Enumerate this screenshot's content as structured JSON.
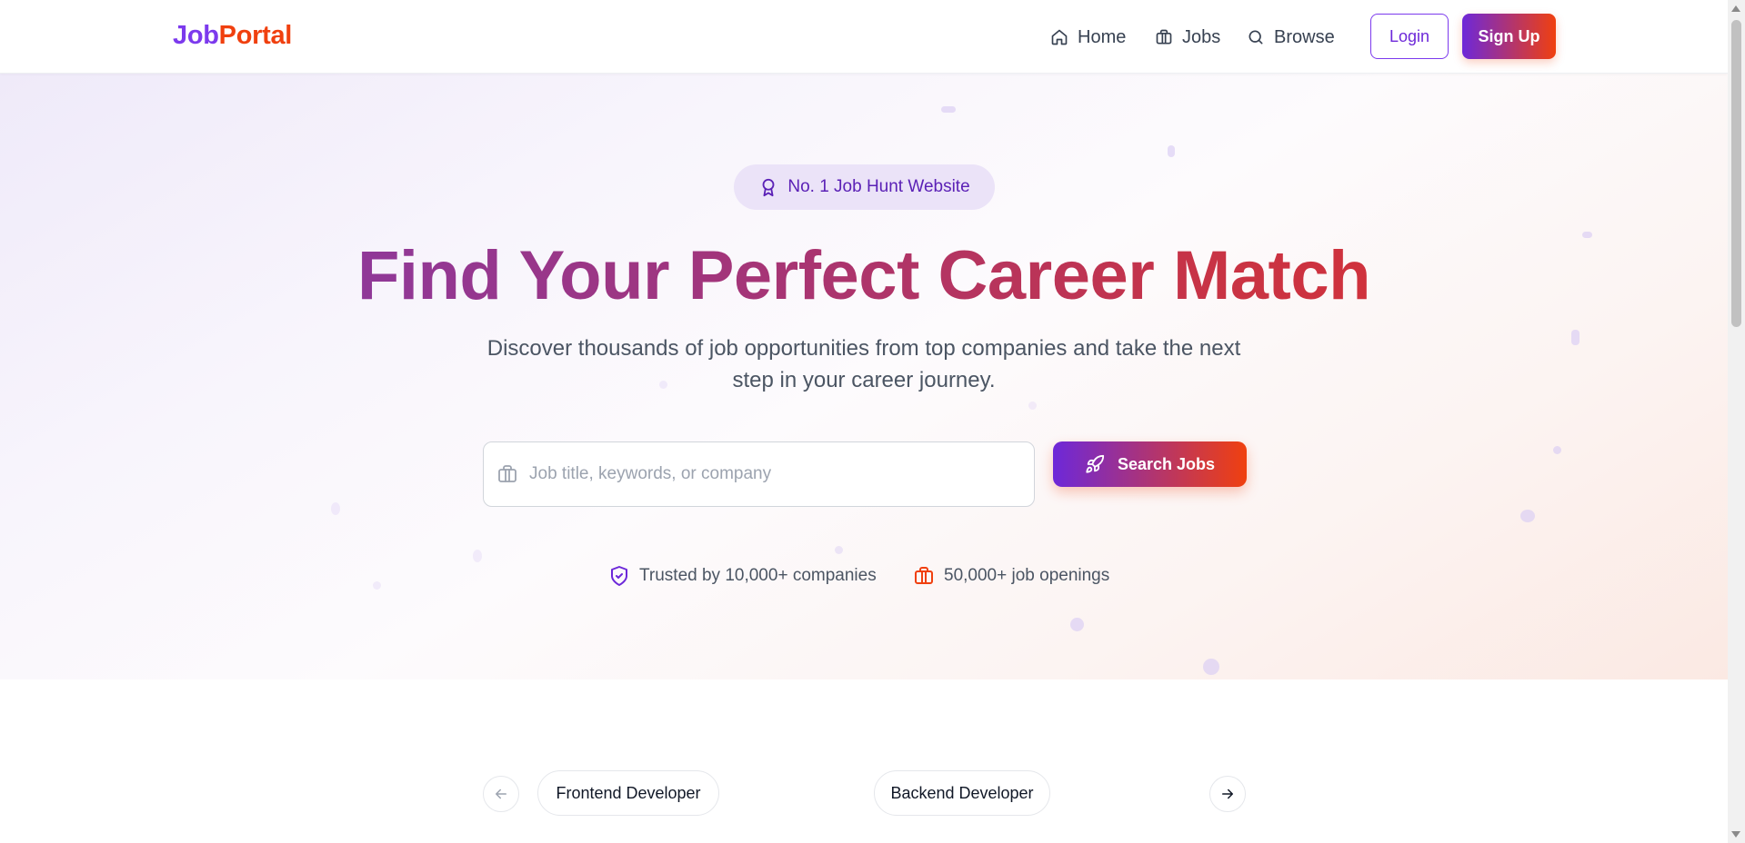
{
  "navbar": {
    "logo_part1": "Job",
    "logo_part2": "Portal",
    "links": [
      {
        "label": "Home",
        "icon": "home-icon"
      },
      {
        "label": "Jobs",
        "icon": "briefcase-icon"
      },
      {
        "label": "Browse",
        "icon": "search-icon"
      }
    ],
    "login_label": "Login",
    "signup_label": "Sign Up"
  },
  "hero": {
    "badge_label": "No. 1 Job Hunt Website",
    "badge_icon": "award-icon",
    "headline": "Find Your Perfect Career Match",
    "subtitle": "Discover thousands of job opportunities from top companies and take the next step in your career journey.",
    "search": {
      "placeholder": "Job title, keywords, or company",
      "value": "",
      "icon": "briefcase-icon",
      "button_label": "Search Jobs",
      "button_icon": "rocket-icon"
    },
    "trust": [
      {
        "label": "Trusted by 10,000+ companies",
        "icon": "shield-check-icon"
      },
      {
        "label": "50,000+ job openings",
        "icon": "briefcase-icon"
      }
    ]
  },
  "carousel": {
    "categories": [
      "Frontend Developer",
      "Backend Developer"
    ],
    "prev_icon": "arrow-left-icon",
    "next_icon": "arrow-right-icon"
  },
  "colors": {
    "brand_purple": "#7c3aed",
    "brand_orange": "#f0400f",
    "text_gray": "#4b5563"
  }
}
